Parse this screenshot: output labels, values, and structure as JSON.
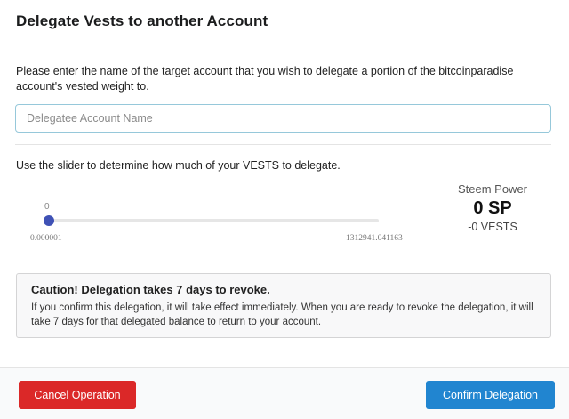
{
  "modal": {
    "title": "Delegate Vests to another Account"
  },
  "form": {
    "prompt": "Please enter the name of the target account that you wish to delegate a portion of the bitcoinparadise account's vested weight to.",
    "account_placeholder": "Delegatee Account Name",
    "account_value": "",
    "slider_instruction": "Use the slider to determine how much of your VESTS to delegate."
  },
  "slider": {
    "current": "0",
    "min_label": "0.000001",
    "max_label": "1312941.041163",
    "value": 0,
    "thumb_color": "#3f51b5"
  },
  "steem_power": {
    "label": "Steem Power",
    "value": "0 SP",
    "vests": "-0 VESTS"
  },
  "caution": {
    "title": "Caution! Delegation takes 7 days to revoke.",
    "body": "If you confirm this delegation, it will take effect immediately. When you are ready to revoke the delegation, it will take 7 days for that delegated balance to return to your account."
  },
  "footer": {
    "cancel_label": "Cancel Operation",
    "confirm_label": "Confirm Delegation"
  },
  "colors": {
    "cancel": "#db2828",
    "confirm": "#2185d0",
    "input_border": "#96c8da"
  }
}
